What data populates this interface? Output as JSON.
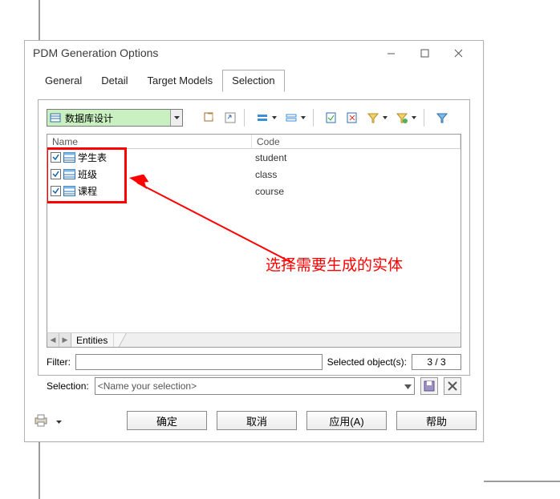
{
  "window": {
    "title": "PDM Generation Options"
  },
  "tabs": {
    "general": "General",
    "detail": "Detail",
    "target_models": "Target Models",
    "selection": "Selection"
  },
  "toolbar": {
    "model_name": "数据库设计"
  },
  "grid": {
    "columns": {
      "name": "Name",
      "code": "Code"
    },
    "rows": [
      {
        "name": "学生表",
        "code": "student"
      },
      {
        "name": "班级",
        "code": "class"
      },
      {
        "name": "课程",
        "code": "course"
      }
    ],
    "footer_tab": "Entities"
  },
  "filter": {
    "label": "Filter:",
    "value": "",
    "selected_label": "Selected object(s):",
    "count": "3 / 3"
  },
  "selection_row": {
    "label": "Selection:",
    "placeholder": "<Name your selection>"
  },
  "annotation": {
    "text": "选择需要生成的实体"
  },
  "buttons": {
    "ok": "确定",
    "cancel": "取消",
    "apply": "应用(A)",
    "help": "帮助"
  }
}
